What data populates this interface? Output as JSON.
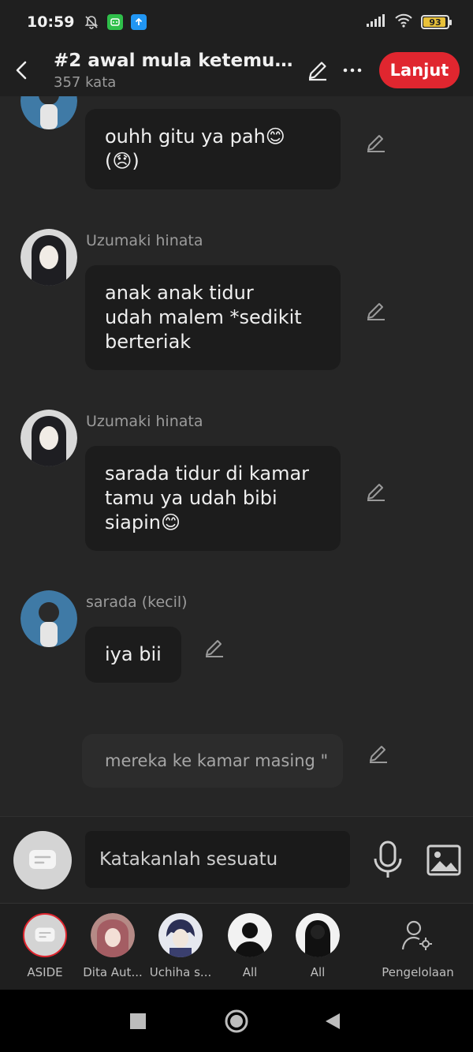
{
  "status": {
    "time": "10:59",
    "battery": "93",
    "battery_level": 0.93
  },
  "header": {
    "title": "#2 awal mula ketemu b...",
    "subtitle": "357 kata",
    "next_label": "Lanjut"
  },
  "messages": [
    {
      "sender": "",
      "lines": [
        "ouhh gitu ya pah😊",
        "(😞)"
      ]
    },
    {
      "sender": "Uzumaki hinata",
      "lines": [
        "anak anak tidur",
        "udah malem *sedikit",
        "berteriak"
      ]
    },
    {
      "sender": "Uzumaki hinata",
      "lines": [
        "sarada tidur di kamar",
        "tamu ya udah bibi",
        "siapin😊"
      ]
    },
    {
      "sender": "sarada (kecil)",
      "lines": [
        "iya bii"
      ]
    }
  ],
  "narration": "mereka ke kamar masing \"",
  "composer": {
    "placeholder": "Katakanlah sesuatu"
  },
  "characters": [
    {
      "label": "ASIDE"
    },
    {
      "label": "Dita Aut..."
    },
    {
      "label": "Uchiha s..."
    },
    {
      "label": "All"
    },
    {
      "label": "All"
    },
    {
      "label": "Pengelolaan"
    }
  ],
  "colors": {
    "accent": "#e0262f",
    "background": "#262626",
    "bubble": "#1c1c1c"
  },
  "icons": {
    "back": "back-arrow-icon",
    "edit": "pencil-icon",
    "more": "more-horizontal-icon",
    "mic": "microphone-icon",
    "image": "image-icon",
    "manage": "user-settings-icon"
  }
}
